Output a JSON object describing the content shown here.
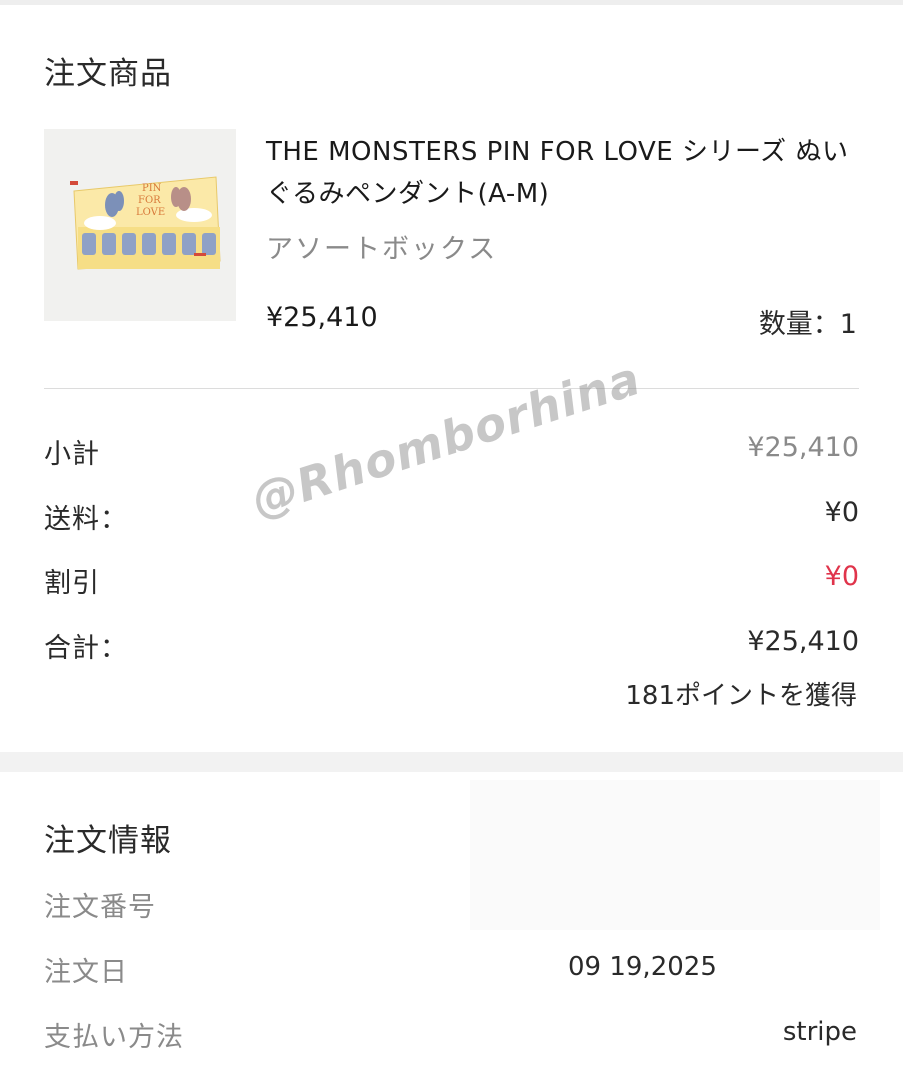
{
  "order_items": {
    "title": "注文商品",
    "product": {
      "name": "THE MONSTERS PIN FOR LOVE シリーズ ぬいぐるみペンダント(A-M)",
      "variant": "アソートボックス",
      "price": "¥25,410",
      "quantity_text": "数量：1",
      "image_text": "PIN FOR LOVE"
    }
  },
  "summary": {
    "subtotal_label": "小計",
    "subtotal_value": "¥25,410",
    "shipping_label": "送料：",
    "shipping_value": "¥0",
    "discount_label": "割引",
    "discount_value": "¥0",
    "total_label": "合計：",
    "total_value": "¥25,410",
    "points_text": "181ポイントを獲得"
  },
  "order_info": {
    "title": "注文情報",
    "order_number_label": "注文番号",
    "order_date_label": "注文日",
    "order_date_value": "09 19,2025",
    "payment_label": "支払い方法",
    "payment_value": "stripe"
  },
  "watermark": "@Rhomborhina",
  "colors": {
    "discount_red": "#e0344b",
    "muted_gray": "#8a8a8a",
    "divider": "#dcdcdc",
    "section_gap": "#f2f2f2"
  }
}
